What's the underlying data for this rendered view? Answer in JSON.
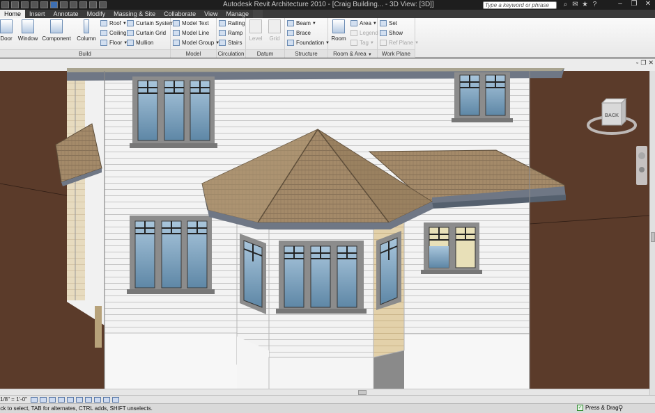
{
  "title_bar": {
    "title": "Autodesk Revit Architecture 2010 - [Craig Building... - 3D View: [3D]]",
    "search_placeholder": "Type a keyword or phrase",
    "icons": [
      "binoculars-icon",
      "star-icon",
      "help-icon",
      "user-icon"
    ]
  },
  "tabs": [
    {
      "label": "Home",
      "active": true
    },
    {
      "label": "Insert",
      "active": false
    },
    {
      "label": "Annotate",
      "active": false
    },
    {
      "label": "Modify",
      "active": false
    },
    {
      "label": "Massing & Site",
      "active": false
    },
    {
      "label": "Collaborate",
      "active": false
    },
    {
      "label": "View",
      "active": false
    },
    {
      "label": "Manage",
      "active": false
    }
  ],
  "ribbon": {
    "build": {
      "title": "Build",
      "door": "Door",
      "window": "Window",
      "component": "Component",
      "column": "Column",
      "roof": "Roof",
      "ceiling": "Ceiling",
      "floor": "Floor",
      "curtain_system": "Curtain System",
      "curtain_grid": "Curtain Grid",
      "mullion": "Mullion"
    },
    "model": {
      "title": "Model",
      "model_text": "Model Text",
      "model_line": "Model Line",
      "model_group": "Model Group"
    },
    "circulation": {
      "title": "Circulation",
      "railing": "Railing",
      "ramp": "Ramp",
      "stairs": "Stairs"
    },
    "datum": {
      "title": "Datum",
      "level": "Level",
      "grid": "Grid"
    },
    "structure": {
      "title": "Structure",
      "beam": "Beam",
      "brace": "Brace",
      "foundation": "Foundation"
    },
    "room_area": {
      "title": "Room & Area",
      "room": "Room",
      "area": "Area",
      "legend": "Legend",
      "tag": "Tag"
    },
    "work_plane": {
      "title": "Work Plane",
      "set": "Set",
      "show": "Show",
      "ref_plane": "Ref Plane"
    }
  },
  "viewcube": {
    "label": "BACK"
  },
  "view_bar": {
    "scale": "1/8\" = 1'-0\""
  },
  "status_bar": {
    "text": "Click to select, TAB for alternates, CTRL adds, SHIFT unselects.",
    "press_drag": "Press & Drag"
  },
  "colors": {
    "siding": "#f2f2f2",
    "trim": "#8f8f8f",
    "roof": "#a08666",
    "ground": "#5a3a28",
    "glass": "#6e96b4"
  }
}
